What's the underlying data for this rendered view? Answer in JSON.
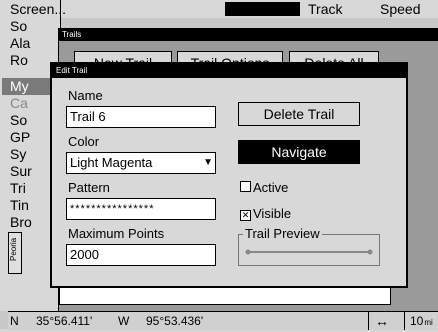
{
  "background": {
    "menu_items": [
      "Screen...",
      "So",
      "Ala",
      "Ro",
      "My",
      "Ca",
      "So",
      "GP",
      "Sy",
      "Sur",
      "Tri",
      "Tin",
      "Bro"
    ],
    "header_track": "Track",
    "header_speed": "Speed",
    "map_label": "Peoria"
  },
  "status_bar": {
    "lat_prefix": "N",
    "lat": "35°56.411'",
    "lon_prefix": "W",
    "lon": "95°53.436'",
    "arrow": "↔",
    "zoom": "10",
    "zoom_unit": "mi"
  },
  "trails_window": {
    "title": "Trails",
    "buttons": [
      "New Trail",
      "Trail Options",
      "Delete All"
    ]
  },
  "edit_trail": {
    "title": "Edit Trail",
    "name_label": "Name",
    "name_value": "Trail 6",
    "color_label": "Color",
    "color_value": "Light Magenta",
    "pattern_label": "Pattern",
    "pattern_value": "****************",
    "max_points_label": "Maximum Points",
    "max_points_value": "2000",
    "delete_label": "Delete Trail",
    "navigate_label": "Navigate",
    "active_label": "Active",
    "active_checked": false,
    "visible_label": "Visible",
    "visible_checked": true,
    "preview_label": "Trail Preview"
  }
}
